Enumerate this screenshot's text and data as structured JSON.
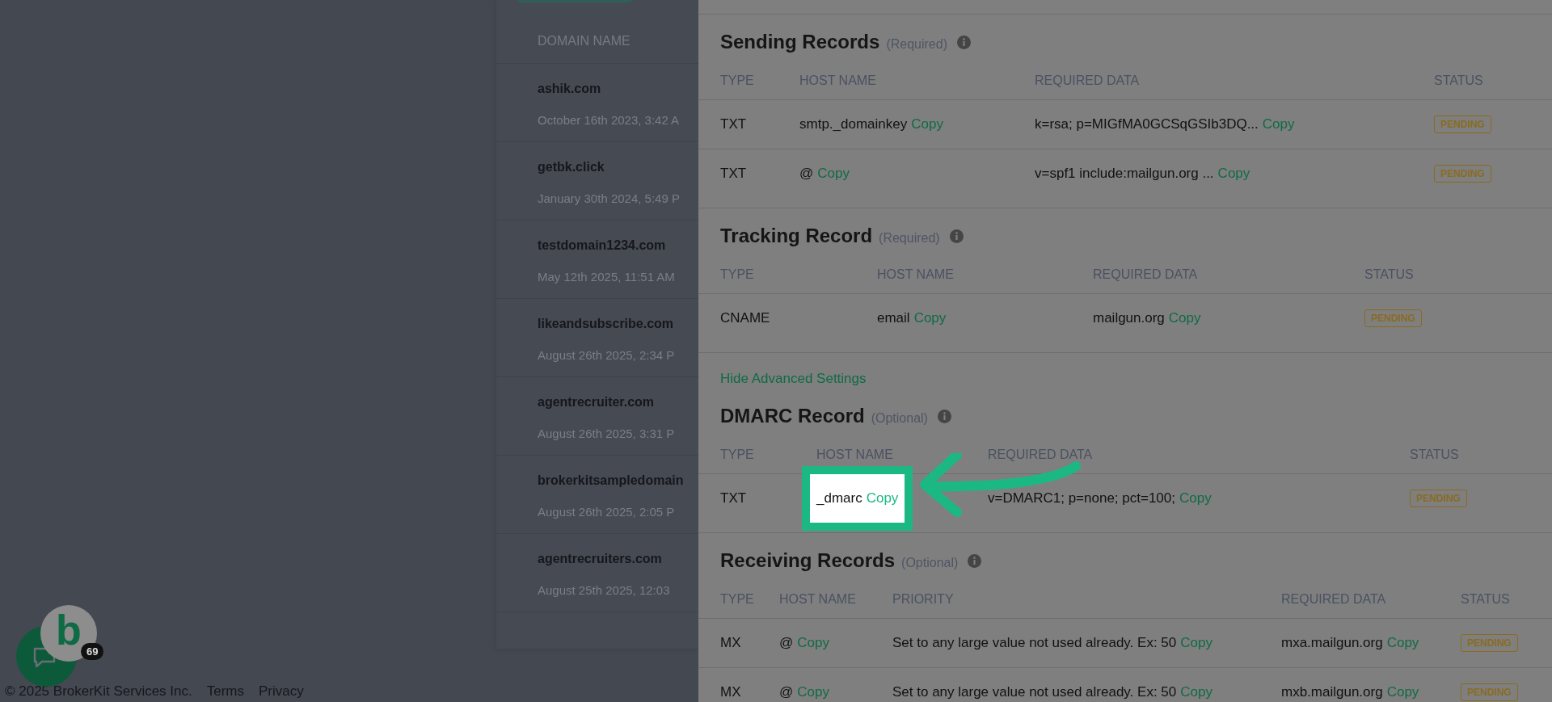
{
  "domains": {
    "column": "DOMAIN NAME",
    "rows": [
      {
        "name": "ashik.com",
        "date": "October 16th 2023, 3:42 A"
      },
      {
        "name": "getbk.click",
        "date": "January 30th 2024, 5:49 P"
      },
      {
        "name": "testdomain1234.com",
        "date": "May 12th 2025, 11:51 AM"
      },
      {
        "name": "likeandsubscribe.com",
        "date": "August 26th 2025, 2:34 P"
      },
      {
        "name": "agentrecruiter.com",
        "date": "August 26th 2025, 3:31 P"
      },
      {
        "name": "brokerkitsampledomain",
        "date": "August 26th 2025, 2:05 P"
      },
      {
        "name": "agentrecruiters.com",
        "date": "August 25th 2025, 12:03"
      }
    ]
  },
  "sections": [
    {
      "title": "Sending Records",
      "tag": "(Required)",
      "columns": [
        "TYPE",
        "HOST NAME",
        "REQUIRED DATA",
        "STATUS"
      ],
      "rows": [
        {
          "cells": [
            {
              "text": "TXT"
            },
            {
              "text": "smtp._domainkey",
              "copy": "Copy"
            },
            {
              "text": "k=rsa; p=MIGfMA0GCSqGSIb3DQ...",
              "copy": "Copy"
            },
            {
              "status": "PENDING"
            }
          ]
        },
        {
          "cells": [
            {
              "text": "TXT"
            },
            {
              "text": "@",
              "copy": "Copy"
            },
            {
              "text": "v=spf1 include:mailgun.org ...",
              "copy": "Copy"
            },
            {
              "status": "PENDING"
            }
          ]
        }
      ]
    },
    {
      "title": "Tracking Record",
      "tag": "(Required)",
      "columns": [
        "TYPE",
        "HOST NAME",
        "REQUIRED DATA",
        "STATUS"
      ],
      "rows": [
        {
          "cells": [
            {
              "text": "CNAME"
            },
            {
              "text": "email",
              "copy": "Copy"
            },
            {
              "text": "mailgun.org",
              "copy": "Copy"
            },
            {
              "status": "PENDING"
            }
          ]
        }
      ]
    },
    {
      "link": "Hide Advanced Settings",
      "title": "DMARC Record",
      "tag": "(Optional)",
      "columns": [
        "TYPE",
        "HOST NAME",
        "REQUIRED DATA",
        "STATUS"
      ],
      "rows": [
        {
          "cells": [
            {
              "text": "TXT"
            },
            {
              "text": "_dmarc",
              "copy": "Copy",
              "highlighted": true
            },
            {
              "text": "v=DMARC1; p=none; pct=100;",
              "copy": "Copy"
            },
            {
              "status": "PENDING"
            }
          ]
        }
      ]
    },
    {
      "title": "Receiving Records",
      "tag": "(Optional)",
      "columns": [
        "TYPE",
        "HOST NAME",
        "PRIORITY",
        "REQUIRED DATA",
        "STATUS"
      ],
      "rows": [
        {
          "cells": [
            {
              "text": "MX"
            },
            {
              "text": "@",
              "copy": "Copy"
            },
            {
              "text": "Set to any large value not used already. Ex: 50",
              "copy": "Copy"
            },
            {
              "text": "mxa.mailgun.org",
              "copy": "Copy"
            },
            {
              "status": "PENDING"
            }
          ]
        },
        {
          "cells": [
            {
              "text": "MX"
            },
            {
              "text": "@",
              "copy": "Copy"
            },
            {
              "text": "Set to any large value not used already. Ex: 50",
              "copy": "Copy"
            },
            {
              "text": "mxb.mailgun.org",
              "copy": "Copy"
            },
            {
              "status": "PENDING"
            }
          ]
        }
      ]
    }
  ],
  "chat": {
    "logo": "b",
    "badge": "69"
  },
  "footer": {
    "copyright": "© 2025 BrokerKit Services Inc.",
    "links": [
      "Terms",
      "Privacy"
    ]
  }
}
